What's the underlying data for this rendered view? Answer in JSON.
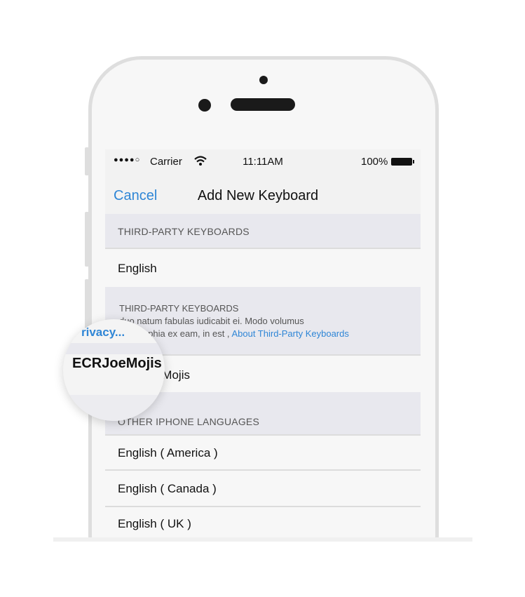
{
  "statusbar": {
    "signal": "●●●●○",
    "carrier": "Carrier",
    "time": "11:11AM",
    "battery": "100%"
  },
  "navbar": {
    "cancel_label": "Cancel",
    "title": "Add New Keyboard"
  },
  "sections": {
    "third_party_header": "THIRD-PARTY KEYBOARDS",
    "third_party_items": [
      "English"
    ],
    "footer_title": "THIRD-PARTY KEYBOARDS",
    "footer_line1": "duo natum fabulas iudicabit ei. Modo volumus",
    "footer_line2": "philosophia ex eam, in est ,",
    "footer_link": "About Third-Party Keyboards",
    "custom_item": "ECRJoeMojis",
    "other_header": "OTHER IPHONE LANGUAGES",
    "other_items": [
      "English ( America )",
      "English ( Canada )",
      "English ( UK )"
    ]
  },
  "magnifier": {
    "privacy": "rivacy...",
    "name": "ECRJoeMojis"
  },
  "colors": {
    "accent": "#2f86d6",
    "frame": "#dedede",
    "section_bg": "#e8e8ee"
  }
}
